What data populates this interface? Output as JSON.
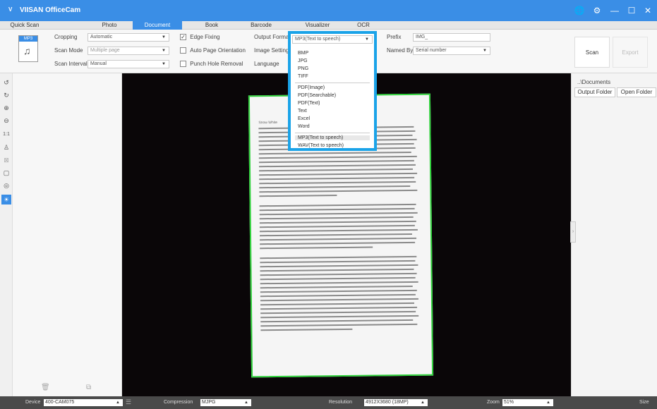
{
  "app": {
    "title": "VIISAN OfficeCam",
    "logo_text": "V"
  },
  "window_controls": {
    "globe": "🌐",
    "settings": "⚙",
    "minimize": "—",
    "maximize": "☐",
    "close": "✕"
  },
  "tabs": [
    "Quick Scan",
    "Photo",
    "Document",
    "Book",
    "Barcode",
    "Visualizer",
    "OCR"
  ],
  "active_tab": "Document",
  "toolbar": {
    "format_icon_label": "MP3",
    "cropping_label": "Cropping",
    "cropping_value": "Automatic",
    "scan_mode_label": "Scan Mode",
    "scan_mode_value": "Multiple page",
    "scan_interval_label": "Scan Interval",
    "scan_interval_value": "Manual",
    "edge_fixing_label": "Edge Fixing",
    "edge_fixing_checked": true,
    "auto_orientation_label": "Auto Page Orientation",
    "punch_hole_label": "Punch Hole Removal",
    "output_format_label": "Output Format",
    "output_format_value": "MP3(Text to speech)",
    "image_setting_label": "Image Setting",
    "language_label": "Language",
    "prefix_label": "Prefix",
    "prefix_value": "IMG_",
    "named_by_label": "Named By",
    "named_by_value": "Serial number",
    "scan_label": "Scan",
    "export_label": "Export"
  },
  "format_options": [
    "BMP",
    "JPG",
    "PNG",
    "TIFF",
    "PDF(Image)",
    "PDF(Searchable)",
    "PDF(Text)",
    "Text",
    "Excel",
    "Word",
    "MP3(Text to speech)",
    "WAV(Text to speech)"
  ],
  "format_selected": "MP3(Text to speech)",
  "right_panel": {
    "path": "..\\Documents",
    "output_folder": "Output Folder",
    "open_folder": "Open Folder"
  },
  "status": {
    "device_label": "Device",
    "device_value": "400-CAM075",
    "compression_label": "Compression",
    "compression_value": "MJPG",
    "resolution_label": "Resolution",
    "resolution_value": "4912X3680 (18MP)",
    "zoom_label": "Zoom",
    "zoom_value": "51%",
    "size_label": "Size"
  },
  "document_preview": {
    "heading": "Snow White"
  },
  "colors": {
    "accent": "#3a8ee6",
    "highlight": "#1aa3e8",
    "crop_border": "#2fd13b"
  }
}
